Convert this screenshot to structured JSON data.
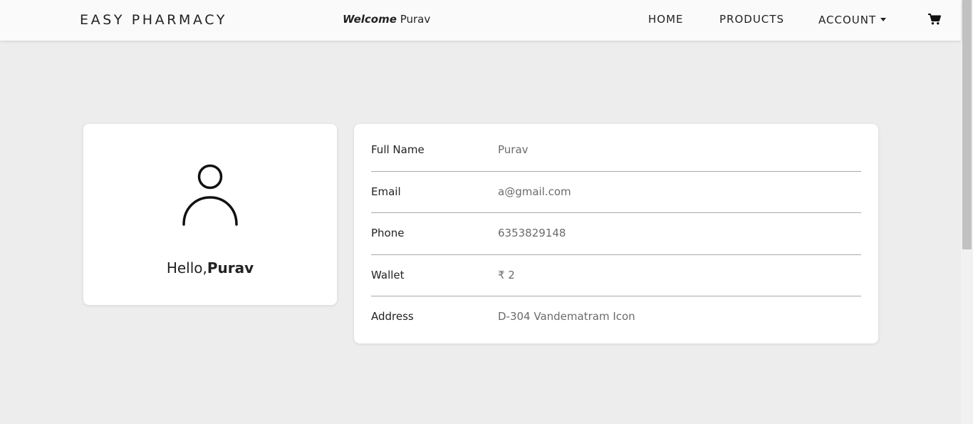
{
  "navbar": {
    "brand": "EASY PHARMACY",
    "welcome_label": "Welcome",
    "welcome_name": "Purav",
    "links": [
      {
        "label": "HOME"
      },
      {
        "label": "PRODUCTS"
      },
      {
        "label": "ACCOUNT"
      }
    ],
    "cart_icon": "cart-icon"
  },
  "profile": {
    "avatar_icon": "user-icon",
    "hello_prefix": "Hello,",
    "hello_name": "Purav"
  },
  "details": {
    "rows": [
      {
        "label": "Full Name",
        "value": "Purav"
      },
      {
        "label": "Email",
        "value": "a@gmail.com"
      },
      {
        "label": "Phone",
        "value": "6353829148"
      },
      {
        "label": "Wallet",
        "value": "₹ 2"
      },
      {
        "label": "Address",
        "value": "D-304 Vandematram Icon"
      }
    ]
  },
  "colors": {
    "background": "#ededed",
    "navbar": "#fafafa",
    "card": "#ffffff",
    "value_text": "#6b6b6b"
  }
}
